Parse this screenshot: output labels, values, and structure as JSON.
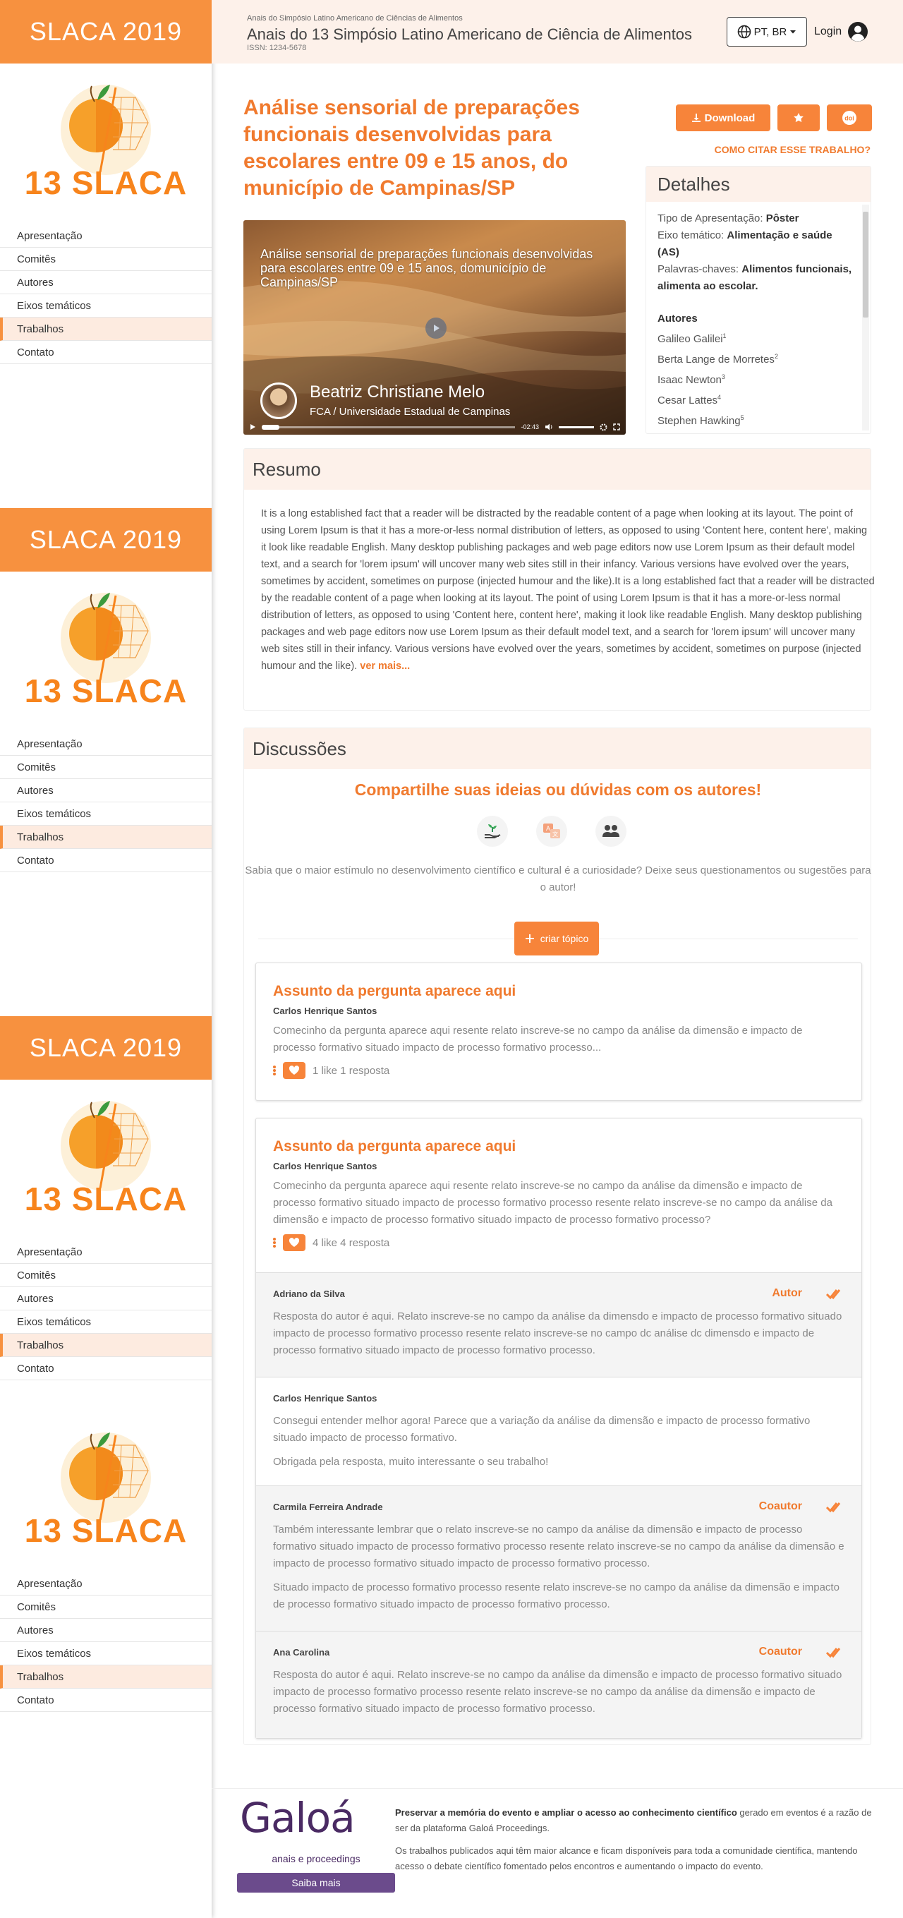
{
  "sidebar": {
    "banner": "SLACA 2019",
    "logo_text": "13 SLACA",
    "nav": [
      "Apresentação",
      "Comitês",
      "Autores",
      "Eixos temáticos",
      "Trabalhos",
      "Contato"
    ],
    "active_index": 4
  },
  "header": {
    "small": "Anais do Simpósio Latino Americano de Ciências de Alimentos",
    "title": "Anais do 13 Simpósio Latino Americano de Ciência de Alimentos",
    "issn": "ISSN: 1234-5678",
    "lang": "PT, BR",
    "login": "Login"
  },
  "work": {
    "title": "Análise sensorial de preparações funcionais desenvolvidas para escolares entre 09 e 15 anos, do município de Campinas/SP",
    "download": "Download",
    "cite": "COMO CITAR ESSE TRABALHO?"
  },
  "video": {
    "title": "Análise sensorial de preparações funcionais desenvolvidas para escolares entre 09 e 15 anos, domunicípio de Campinas/SP",
    "presenter": "Beatriz Christiane Melo",
    "affiliation": "FCA / Universidade Estadual de Campinas",
    "time": "-02:43",
    "progress": 0.07
  },
  "details": {
    "heading": "Detalhes",
    "type_label": "Tipo de Apresentação:",
    "type_value": "Pôster",
    "axis_label": "Eixo temático:",
    "axis_value": "Alimentação e saúde (AS)",
    "keywords_label": "Palavras-chaves:",
    "keywords_value": "Alimentos funcionais, alimenta ao escolar.",
    "authors_heading": "Autores",
    "authors": [
      {
        "name": "Galileo Galilei",
        "sup": "1"
      },
      {
        "name": "Berta Lange de Morretes",
        "sup": "2"
      },
      {
        "name": "Isaac Newton",
        "sup": "3"
      },
      {
        "name": "Cesar Lattes",
        "sup": "4"
      },
      {
        "name": "Stephen Hawking",
        "sup": "5"
      }
    ]
  },
  "resumo": {
    "heading": "Resumo",
    "text": "It is a long established fact that a reader will be distracted by the readable content of a page when looking at its layout. The point of using Lorem Ipsum is that it has a more-or-less normal distribution of letters, as opposed to using 'Content here, content here', making it look like readable English. Many desktop publishing packages and web page editors now use Lorem Ipsum as their default model text, and a search for 'lorem ipsum' will uncover many web sites still in their infancy. Various versions have evolved over the years, sometimes by accident, sometimes on purpose (injected humour and the like).It is a long established fact that a reader will be distracted by the readable content of a page when looking at its layout. The point of using Lorem Ipsum is that it has a more-or-less normal distribution of letters, as opposed to using 'Content here, content here', making it look like readable English. Many desktop publishing packages and web page editors now use Lorem Ipsum as their default model text, and a search for 'lorem ipsum' will uncover many web sites still in their infancy. Various versions have evolved over the years, sometimes by accident, sometimes on purpose (injected humour and the like).",
    "more": "ver mais..."
  },
  "discussions": {
    "heading": "Discussões",
    "title": "Compartilhe suas ideias ou dúvidas com os autores!",
    "subtitle": "Sabia que o maior estímulo no desenvolvimento científico e cultural é a curiosidade? Deixe seus questionamentos ou sugestões para o autor!",
    "new_topic": "criar tópico",
    "topics": [
      {
        "title": "Assunto da pergunta aparece aqui",
        "author": "Carlos Henrique Santos",
        "text": "Comecinho da pergunta aparece aqui resente relato inscreve-se no campo da análise da dimensão e impacto de processo formativo situado impacto de processo formativo processo...",
        "stats": "1 like 1 resposta"
      },
      {
        "title": "Assunto da pergunta aparece aqui",
        "author": "Carlos Henrique Santos",
        "text": "Comecinho da pergunta aparece aqui resente relato inscreve-se no campo da análise da dimensão e impacto de processo formativo situado impacto de processo formativo processo resente relato inscreve-se no campo da análise da dimensão e impacto de processo formativo situado impacto de processo formativo processo?",
        "stats": "4 like 4 resposta"
      }
    ],
    "replies": [
      {
        "author": "Adriano da Silva",
        "role": "Autor",
        "paragraphs": [
          "Resposta do autor é aqui. Relato inscreve-se no campo da análise da dimensdo e impacto de processo formativo situado impacto de processo formativo processo resente relato inscreve-se no campo dc análise dc dimensdo e impacto de processo formativo situado impacto de processo formativo processo."
        ]
      },
      {
        "author": "Carlos Henrique Santos",
        "role": "",
        "paragraphs": [
          "Consegui entender melhor agora! Parece que a variação da análise da dimensão e impacto de processo formativo situado impacto de processo formativo.",
          "Obrigada pela resposta, muito interessante o seu trabalho!"
        ]
      },
      {
        "author": "Carmila Ferreira Andrade",
        "role": "Coautor",
        "paragraphs": [
          "Também interessante lembrar que o relato inscreve-se no campo da análise da dimensão e impacto de processo formativo situado impacto de processo formativo processo resente relato inscreve-se no campo da análise da dimensão e impacto de processo formativo situado impacto de processo formativo processo.",
          "Situado impacto de processo formativo processo resente relato inscreve-se no campo da análise da dimensão e impacto de processo formativo situado impacto de processo formativo processo."
        ]
      },
      {
        "author": "Ana Carolina",
        "role": "Coautor",
        "paragraphs": [
          "Resposta do autor é aqui. Relato inscreve-se no campo da análise da dimensão e impacto de processo formativo situado impacto de processo formativo processo resente relato inscreve-se no campo da análise da dimensão e impacto de processo formativo situado impacto de processo formativo processo."
        ]
      }
    ]
  },
  "footer": {
    "brand": "Galoá",
    "brand_sub": "anais e proceedings",
    "button": "Saiba mais",
    "bold": "Preservar a memória do evento e ampliar o acesso ao conhecimento científico",
    "text1": " gerado em eventos é a razão de ser da plataforma Galoá Proceedings.",
    "text2": "Os trabalhos publicados aqui têm maior alcance e ficam disponíveis para toda a comunidade científica, mantendo acesso o debate científico fomentado pelos encontros e aumentando o impacto do evento."
  },
  "colors": {
    "accent": "#f7913f",
    "title": "#f07a2e",
    "tint": "#fdf1ea",
    "brand": "#4a2a63"
  },
  "icons": [
    "download-icon",
    "star-icon",
    "doi-icon",
    "globe-icon",
    "user-icon",
    "play-icon",
    "plant-hand-icon",
    "translate-icon",
    "people-icon",
    "plus-icon",
    "heart-icon",
    "check-icon",
    "more-vertical-icon"
  ]
}
